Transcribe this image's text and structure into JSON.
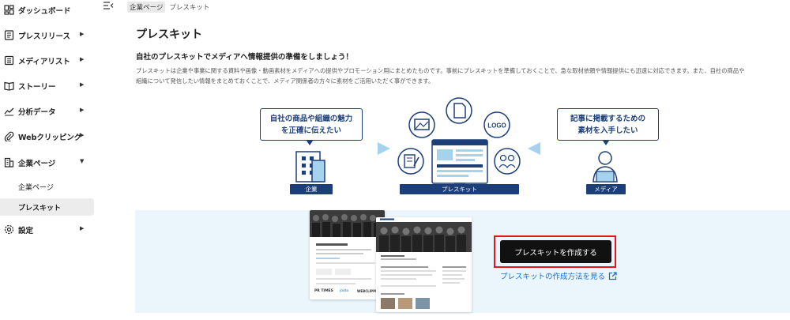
{
  "sidebar": {
    "items": [
      {
        "label": "ダッシュボード",
        "icon": "dashboard-icon",
        "has_caret": false
      },
      {
        "label": "プレスリリース",
        "icon": "document-icon",
        "has_caret": true
      },
      {
        "label": "メディアリスト",
        "icon": "list-icon",
        "has_caret": true
      },
      {
        "label": "ストーリー",
        "icon": "book-icon",
        "has_caret": true
      },
      {
        "label": "分析データ",
        "icon": "chart-icon",
        "has_caret": true
      },
      {
        "label": "Webクリッピング",
        "icon": "paperclip-icon",
        "has_caret": true
      },
      {
        "label": "企業ページ",
        "icon": "building-icon",
        "has_caret": true,
        "expanded": true
      },
      {
        "label": "設定",
        "icon": "gear-icon",
        "has_caret": true
      }
    ],
    "sub_items": [
      {
        "label": "企業ページ",
        "active": false
      },
      {
        "label": "プレスキット",
        "active": true
      }
    ]
  },
  "breadcrumb": {
    "parent": "企業ページ",
    "current": "プレスキット"
  },
  "page": {
    "title": "プレスキット",
    "subtitle": "自社のプレスキットでメディアへ情報提供の準備をしましょう！",
    "description_line1": "プレスキットは企業や事業に関する資料や画像・動画素材をメディアへの提供やプロモーション用にまとめたものです。事前にプレスキットを準備しておくことで、急な取材依頼や情報提供にも迅速に対応できます。また、自社の商品や",
    "description_line2": "組織について発信したい情報をまとめておくことで、メディア関係者の方々に素材をご活用いただく事ができます。"
  },
  "illustration": {
    "left_bubble_line1": "自社の商品や組織の魅力",
    "left_bubble_line2": "を正確に伝えたい",
    "right_bubble_line1": "記事に掲載するための",
    "right_bubble_line2": "素材を入手したい",
    "company_label": "企業",
    "presskit_label": "プレスキット",
    "media_label": "メディア",
    "logo_text": "LOGO"
  },
  "cta": {
    "create_button": "プレスキットを作成する",
    "howto_link": "プレスキットの作成方法を見る"
  },
  "mockups": {
    "brand_left": "PR TIMES",
    "brand_mid": "jooto",
    "brand_right": "WEBCLIPPING"
  },
  "colors": {
    "navy": "#1d3f79",
    "light_blue": "#a5d3ee",
    "panel_bg": "#eaf6fc",
    "link": "#1d6ec9",
    "highlight_border": "#e21818"
  }
}
